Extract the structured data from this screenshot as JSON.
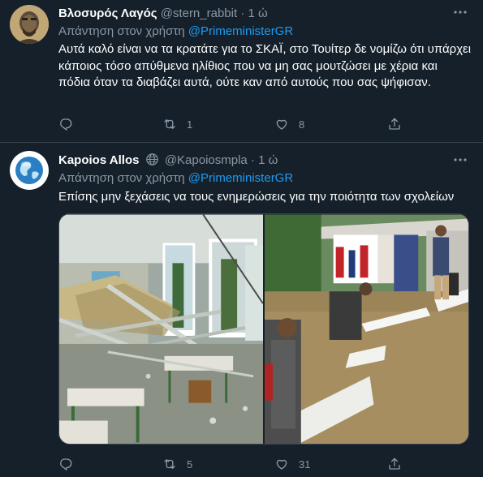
{
  "tweets": [
    {
      "name": "Βλοσυρός Λαγός",
      "handle": "@stern_rabbit",
      "dot": "·",
      "time": "1 ώ",
      "reply_prefix": "Απάντηση στον χρήστη",
      "reply_mention": "@PrimeministerGR",
      "text": "Αυτά καλό είναι να τα κρατάτε για το ΣΚΑΪ, στο Τουίτερ δε νομίζω ότι υπάρχει κάποιος τόσο απύθμενα ηλίθιος που να μη σας μουτζώσει με χέρια και πόδια όταν τα διαβάζει αυτά, ούτε καν από αυτούς που σας ψήφισαν.",
      "retweets": "1",
      "likes": "8",
      "avatar_icon": "avatar-portrait-icon"
    },
    {
      "name": "Kapoios Allos",
      "handle": "@Kapoiosmpla",
      "dot": "·",
      "time": "1 ώ",
      "reply_prefix": "Απάντηση στον χρήστη",
      "reply_mention": "@PrimeministerGR",
      "text": "Επίσης μην ξεχάσεις να τους ενημερώσεις για την ποιότητα των σχολείων",
      "retweets": "5",
      "likes": "31",
      "avatar_icon": "globe-icon",
      "media": [
        "collapsed-classroom-ceiling-photo",
        "flooded-schoolyard-photo"
      ]
    }
  ],
  "colors": {
    "background": "#15202b",
    "secondary_text": "#8b98a5",
    "accent": "#1d9bf0",
    "divider": "#38444d"
  },
  "icons": [
    "more-icon",
    "reply-icon",
    "retweet-icon",
    "like-icon",
    "share-icon",
    "globe-icon"
  ]
}
